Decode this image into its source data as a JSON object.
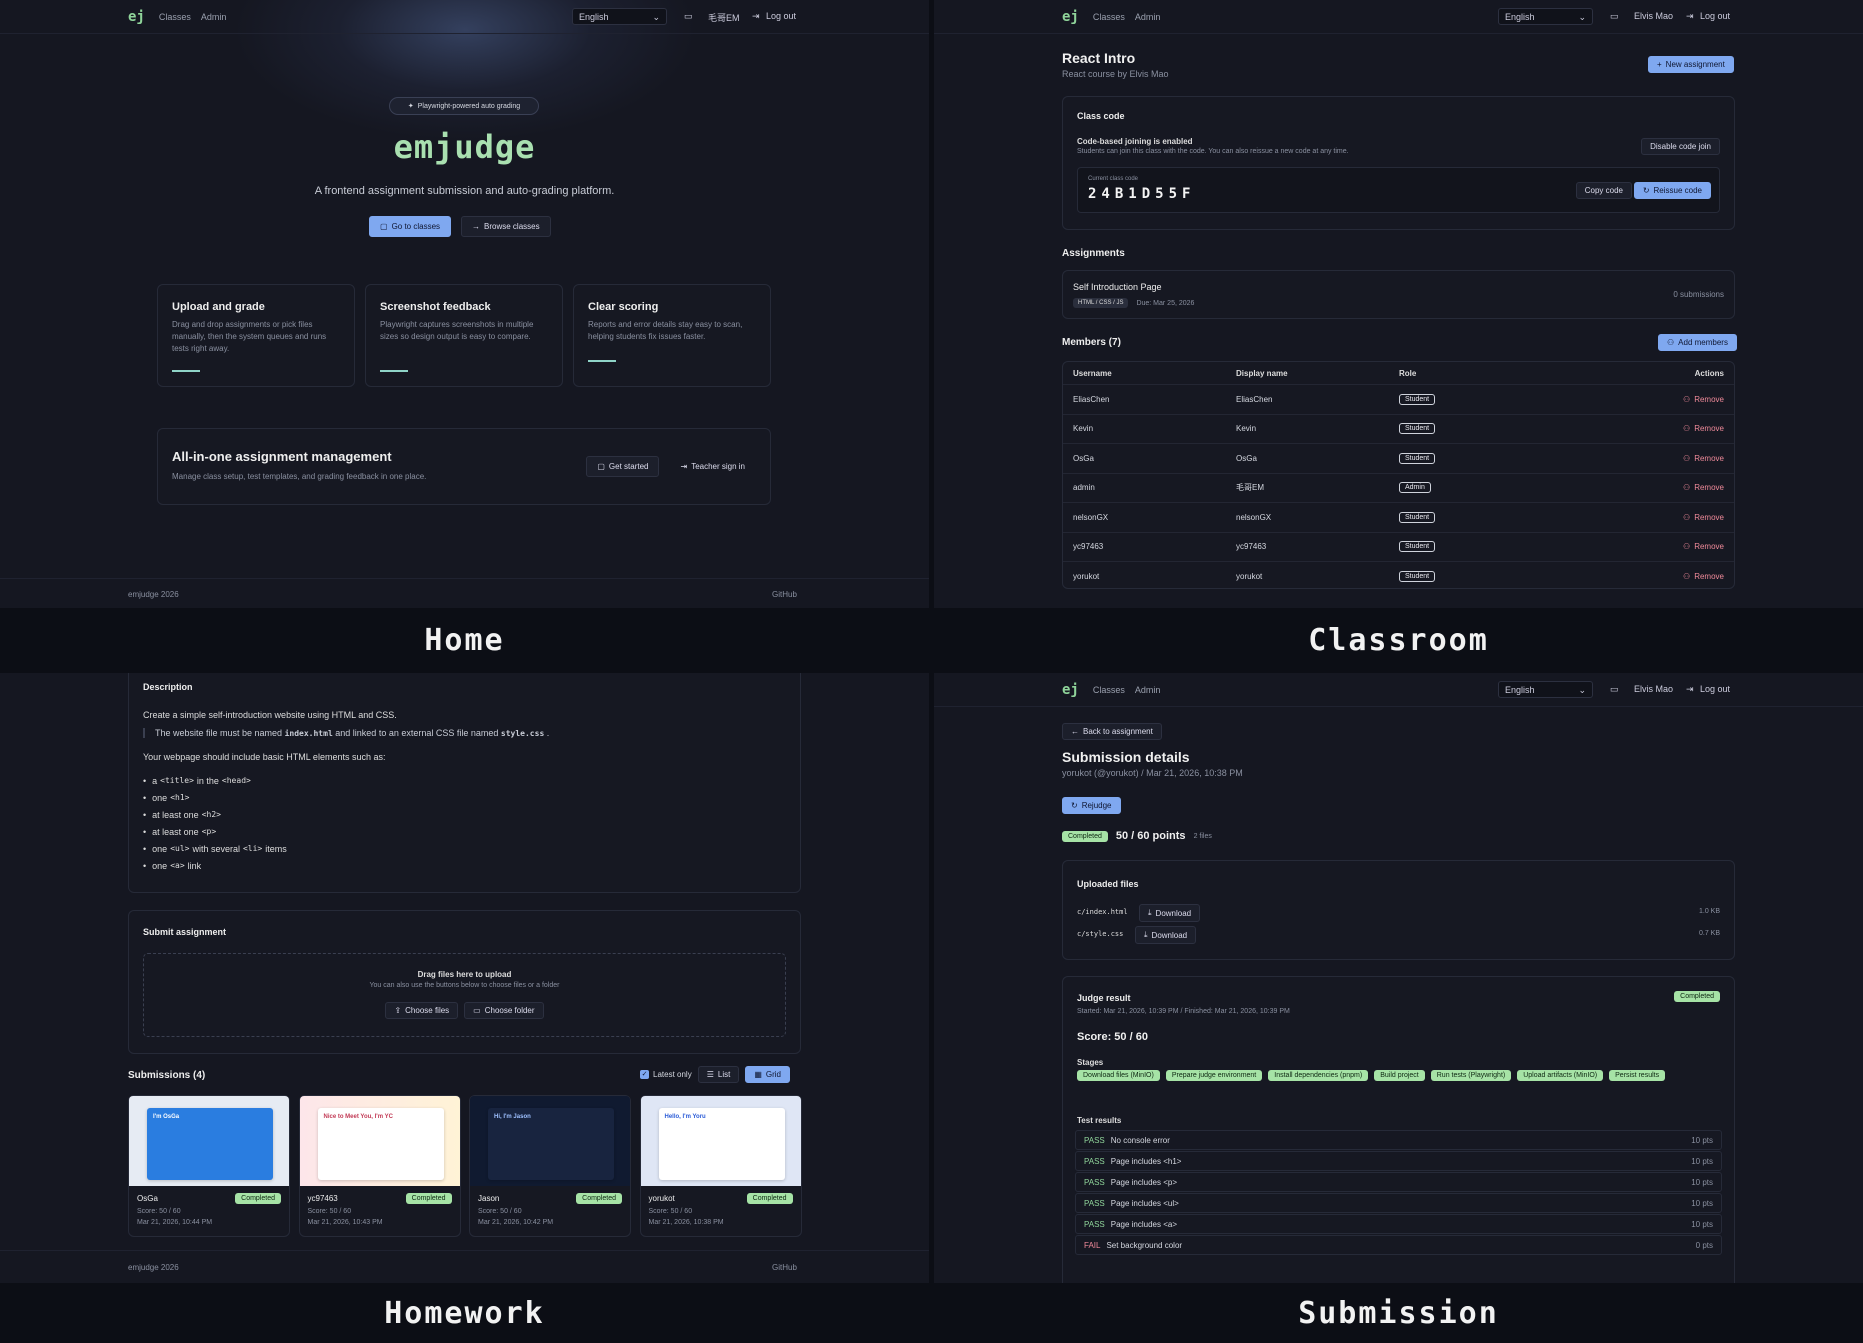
{
  "nav": {
    "logo": "ej",
    "classes": "Classes",
    "admin": "Admin",
    "language": "English",
    "logout": "Log out",
    "user_home": "毛哥EM",
    "user_other": "Elvis Mao"
  },
  "captions": {
    "home": "Home",
    "classroom": "Classroom",
    "homework": "Homework",
    "submission": "Submission"
  },
  "home": {
    "pill": "Playwright-powered auto grading",
    "logo": "emjudge",
    "tagline": "A frontend assignment submission and auto-grading platform.",
    "go_classes": "Go to classes",
    "browse": "Browse classes",
    "features": [
      {
        "title": "Upload and grade",
        "desc": "Drag and drop assignments or pick files manually, then the system queues and runs tests right away."
      },
      {
        "title": "Screenshot feedback",
        "desc": "Playwright captures screenshots in multiple sizes so design output is easy to compare."
      },
      {
        "title": "Clear scoring",
        "desc": "Reports and error details stay easy to scan, helping students fix issues faster."
      }
    ],
    "cta_title": "All-in-one assignment management",
    "cta_desc": "Manage class setup, test templates, and grading feedback in one place.",
    "get_started": "Get started",
    "teacher_signin": "Teacher sign in",
    "footer_left": "emjudge 2026",
    "footer_right": "GitHub"
  },
  "classroom": {
    "title": "React Intro",
    "subtitle": "React course by Elvis Mao",
    "new_assignment": "New assignment",
    "class_code_title": "Class code",
    "joining": "Code-based joining is enabled",
    "joining_desc": "Students can join this class with the code. You can also reissue a new code at any time.",
    "disable": "Disable code join",
    "current_label": "Current class code",
    "code": "24B1D55F",
    "copy": "Copy code",
    "reissue": "Reissue code",
    "assignments_title": "Assignments",
    "assignment": {
      "name": "Self Introduction Page",
      "tag": "HTML / CSS / JS",
      "due": "Due: Mar 25, 2026",
      "submissions": "0 submissions"
    },
    "members_title": "Members (7)",
    "add_members": "Add members",
    "headers": [
      "Username",
      "Display name",
      "Role",
      "Actions"
    ],
    "remove": "Remove",
    "members": [
      {
        "u": "EliasChen",
        "d": "EliasChen",
        "r": "Student"
      },
      {
        "u": "Kevin",
        "d": "Kevin",
        "r": "Student"
      },
      {
        "u": "OsGa",
        "d": "OsGa",
        "r": "Student"
      },
      {
        "u": "admin",
        "d": "毛哥EM",
        "r": "Admin"
      },
      {
        "u": "nelsonGX",
        "d": "nelsonGX",
        "r": "Student"
      },
      {
        "u": "yc97463",
        "d": "yc97463",
        "r": "Student"
      },
      {
        "u": "yorukot",
        "d": "yorukot",
        "r": "Student"
      }
    ]
  },
  "homework": {
    "desc_title": "Description",
    "intro": "Create a simple self-introduction website using HTML and CSS.",
    "quote_a": "The website file must be named",
    "quote_file1": "index.html",
    "quote_b": "and linked to an external CSS file named",
    "quote_file2": "style.css",
    "list_intro": "Your webpage should include basic HTML elements such as:",
    "items": [
      [
        "a ",
        "<title>",
        " in the ",
        "<head>"
      ],
      [
        "one ",
        "<h1>",
        "",
        ""
      ],
      [
        "at least one ",
        "<h2>",
        "",
        ""
      ],
      [
        "at least one ",
        "<p>",
        "",
        ""
      ],
      [
        "one ",
        "<ul>",
        " with several ",
        "<li>",
        " items"
      ],
      [
        "one ",
        "<a>",
        " link",
        ""
      ]
    ],
    "submit_title": "Submit assignment",
    "drag": "Drag files here to upload",
    "drag_desc": "You can also use the buttons below to choose files or a folder",
    "choose_files": "Choose files",
    "choose_folder": "Choose folder",
    "subs_title": "Submissions (4)",
    "latest": "Latest only",
    "list": "List",
    "grid": "Grid",
    "subs": [
      {
        "name": "OsGa",
        "status": "Completed",
        "score": "Score: 50 / 60",
        "time": "Mar 21, 2026, 10:44 PM",
        "thumb": "I'm OsGa"
      },
      {
        "name": "yc97463",
        "status": "Completed",
        "score": "Score: 50 / 60",
        "time": "Mar 21, 2026, 10:43 PM",
        "thumb": "Nice to Meet You, I'm YC"
      },
      {
        "name": "Jason",
        "status": "Completed",
        "score": "Score: 50 / 60",
        "time": "Mar 21, 2026, 10:42 PM",
        "thumb": "Hi, I'm Jason"
      },
      {
        "name": "yorukot",
        "status": "Completed",
        "score": "Score: 50 / 60",
        "time": "Mar 21, 2026, 10:38 PM",
        "thumb": "Hello, I'm Yoru"
      }
    ],
    "footer_left": "emjudge 2026",
    "footer_right": "GitHub"
  },
  "submission": {
    "back": "Back to assignment",
    "title": "Submission details",
    "meta": "yorukot (@yorukot) / Mar 21, 2026, 10:38 PM",
    "rejudge": "Rejudge",
    "status": "Completed",
    "points": "50 / 60 points",
    "files_count": "2 files",
    "uploaded_title": "Uploaded files",
    "download": "Download",
    "files": [
      {
        "name": "c/index.html",
        "size": "1.0 KB"
      },
      {
        "name": "c/style.css",
        "size": "0.7 KB"
      }
    ],
    "judge_title": "Judge result",
    "judge_status": "Completed",
    "judge_time": "Started: Mar 21, 2026, 10:39 PM / Finished: Mar 21, 2026, 10:39 PM",
    "score": "Score: 50 / 60",
    "stages_title": "Stages",
    "stages": [
      "Download files (MinIO)",
      "Prepare judge environment",
      "Install dependencies (pnpm)",
      "Build project",
      "Run tests (Playwright)",
      "Upload artifacts (MinIO)",
      "Persist results"
    ],
    "tests_title": "Test results",
    "tests": [
      {
        "s": "PASS",
        "n": "No console error",
        "p": "10 pts"
      },
      {
        "s": "PASS",
        "n": "Page includes <h1>",
        "p": "10 pts"
      },
      {
        "s": "PASS",
        "n": "Page includes <p>",
        "p": "10 pts"
      },
      {
        "s": "PASS",
        "n": "Page includes <ul>",
        "p": "10 pts"
      },
      {
        "s": "PASS",
        "n": "Page includes <a>",
        "p": "10 pts"
      },
      {
        "s": "FAIL",
        "n": "Set background color",
        "p": "0 pts"
      }
    ]
  }
}
